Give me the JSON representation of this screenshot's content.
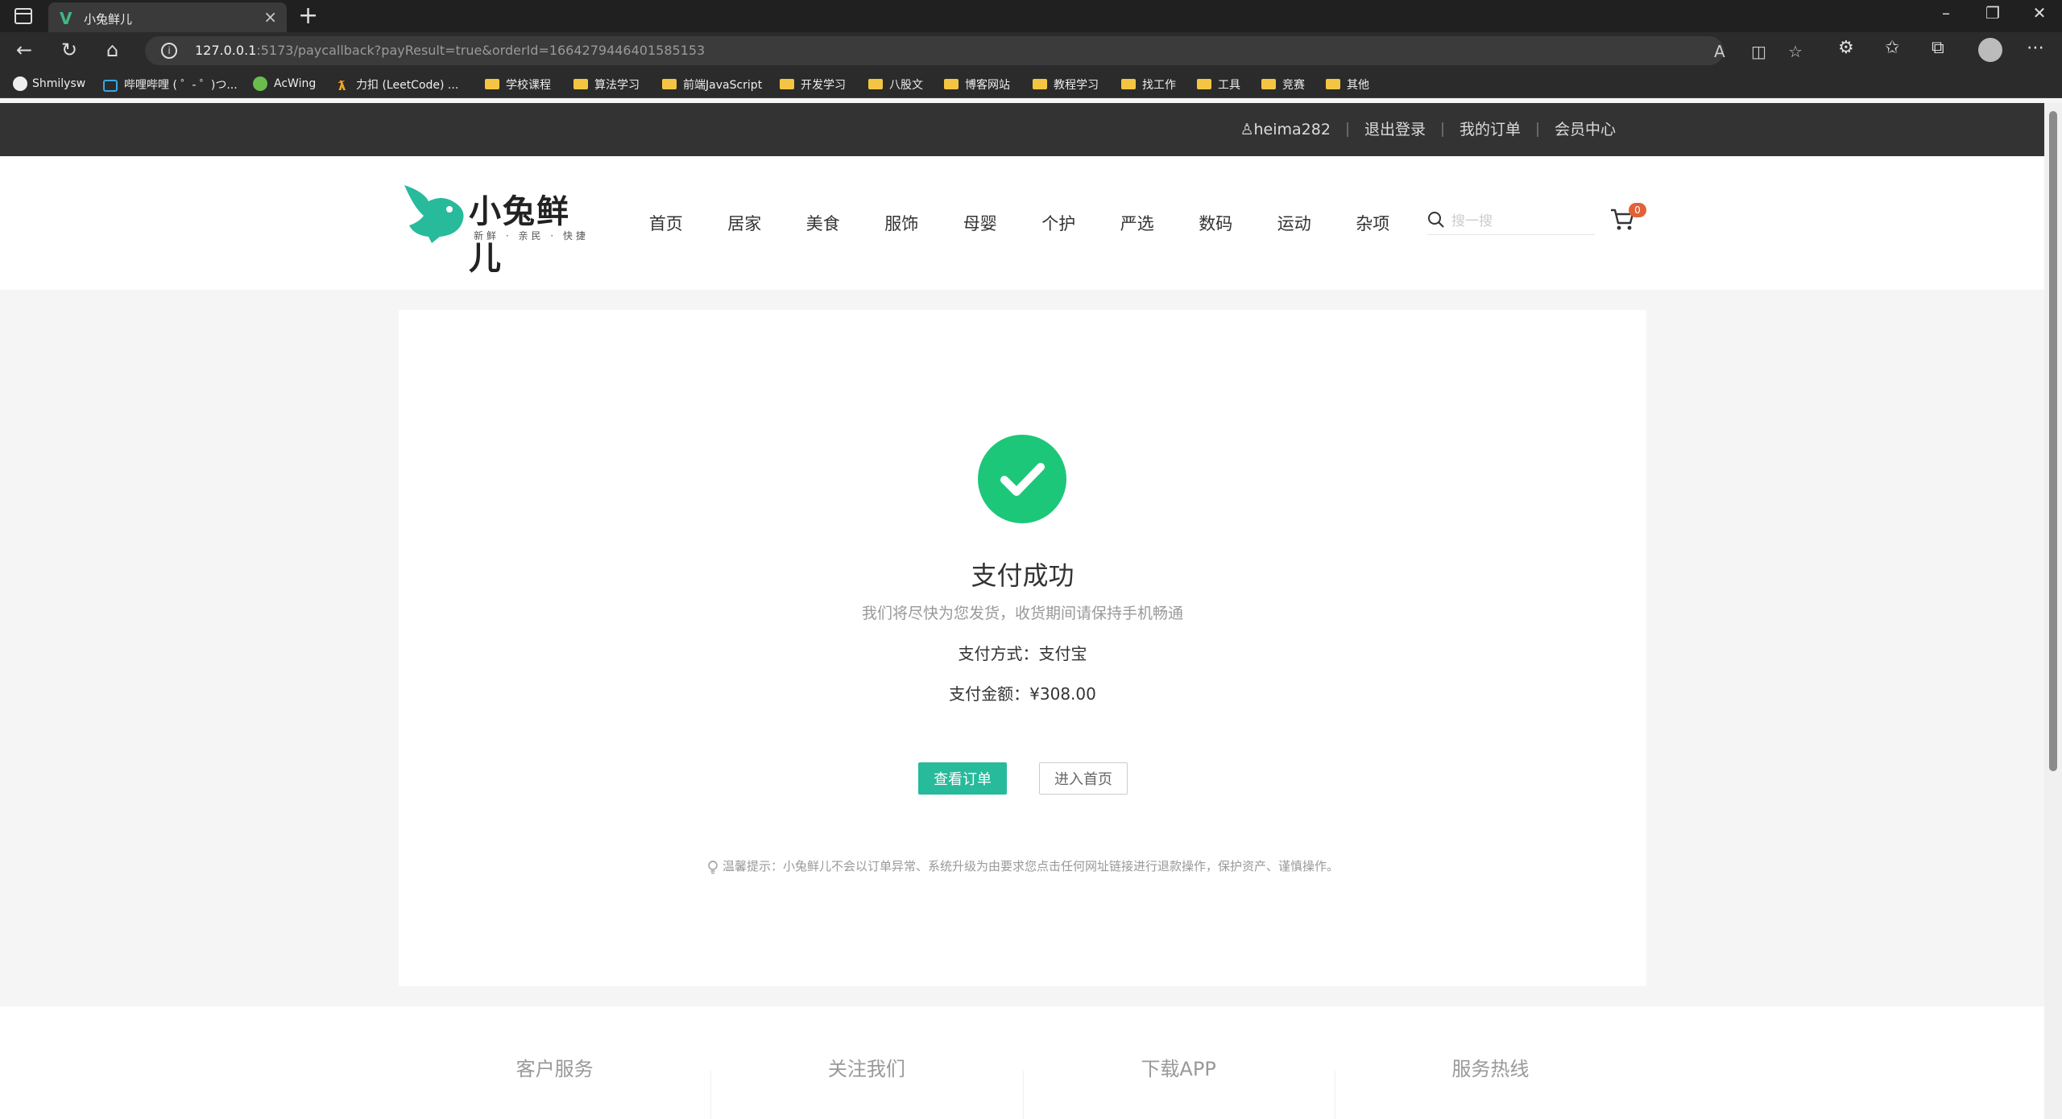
{
  "browser": {
    "tab_title": "小兔鲜儿",
    "tab_logo": "V",
    "url_host": "127.0.0.1",
    "url_rest": ":5173/paycallback?payResult=true&orderId=1664279446401585153",
    "bookmarks": [
      {
        "label": "Shmilysw",
        "icon": "github-icon"
      },
      {
        "label": "哔哩哔哩 ( ゜- ゜)つ...",
        "icon": "bilibili-icon"
      },
      {
        "label": "AcWing",
        "icon": "acwing-icon"
      },
      {
        "label": "力扣 (LeetCode) ...",
        "icon": "leetcode-icon"
      },
      {
        "label": "学校课程",
        "icon": "folder-icon"
      },
      {
        "label": "算法学习",
        "icon": "folder-icon"
      },
      {
        "label": "前端JavaScript",
        "icon": "folder-icon"
      },
      {
        "label": "开发学习",
        "icon": "folder-icon"
      },
      {
        "label": "八股文",
        "icon": "folder-icon"
      },
      {
        "label": "博客网站",
        "icon": "folder-icon"
      },
      {
        "label": "教程学习",
        "icon": "folder-icon"
      },
      {
        "label": "找工作",
        "icon": "folder-icon"
      },
      {
        "label": "工具",
        "icon": "folder-icon"
      },
      {
        "label": "竞赛",
        "icon": "folder-icon"
      },
      {
        "label": "其他",
        "icon": "folder-icon"
      }
    ]
  },
  "topnav": {
    "username": "heima282",
    "logout": "退出登录",
    "orders": "我的订单",
    "member": "会员中心"
  },
  "header": {
    "logo_text": "小兔鲜儿",
    "logo_sub": "新鲜 · 亲民 · 快捷",
    "menu": [
      "首页",
      "居家",
      "美食",
      "服饰",
      "母婴",
      "个护",
      "严选",
      "数码",
      "运动",
      "杂项"
    ],
    "search_placeholder": "搜一搜",
    "cart_count": "0"
  },
  "pay": {
    "title": "支付成功",
    "tip": "我们将尽快为您发货，收货期间请保持手机畅通",
    "method_label": "支付方式：支付宝",
    "amount_label": "支付金额：¥308.00",
    "view_order": "查看订单",
    "go_home": "进入首页",
    "notice": "温馨提示：小兔鲜儿不会以订单异常、系统升级为由要求您点击任何网址链接进行退款操作，保护资产、谨慎操作。"
  },
  "footer": [
    "客户服务",
    "关注我们",
    "下载APP",
    "服务热线"
  ],
  "colors": {
    "brand": "#27ba9b",
    "success": "#1dc779",
    "badge": "#e26237",
    "topnav_bg": "#333333"
  }
}
